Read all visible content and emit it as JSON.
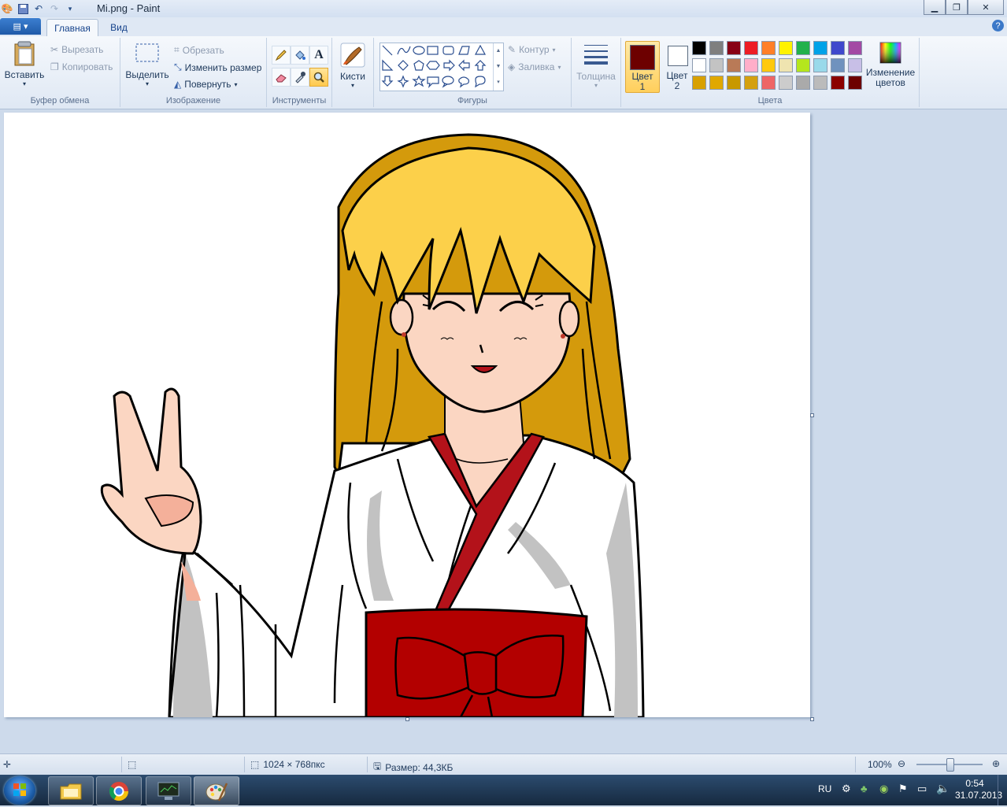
{
  "window": {
    "title": "Mi.png - Paint"
  },
  "tabs": {
    "file": "▤ ▾",
    "home": "Главная",
    "view": "Вид",
    "help": "?"
  },
  "clipboard": {
    "paste": "Вставить",
    "cut": "Вырезать",
    "copy": "Копировать",
    "label": "Буфер обмена"
  },
  "image": {
    "select": "Выделить",
    "crop": "Обрезать",
    "resize": "Изменить размер",
    "rotate": "Повернуть",
    "label": "Изображение"
  },
  "tools": {
    "label": "Инструменты"
  },
  "brushes": {
    "label": "Кисти"
  },
  "shapes": {
    "outline": "Контур",
    "fill": "Заливка",
    "label": "Фигуры"
  },
  "size": {
    "label": "Толщина"
  },
  "colors": {
    "color1_label": "Цвет",
    "color1_num": "1",
    "color2_label": "Цвет",
    "color2_num": "2",
    "edit_line1": "Изменение",
    "edit_line2": "цветов",
    "label": "Цвета",
    "color1_value": "#6d0000",
    "color2_value": "#ffffff",
    "palette": [
      "#000000",
      "#7f7f7f",
      "#880015",
      "#ed1c24",
      "#ff7f27",
      "#fff200",
      "#22b14c",
      "#00a2e8",
      "#3f48cc",
      "#a349a4",
      "#ffffff",
      "#c3c3c3",
      "#b97a57",
      "#ffaec9",
      "#ffc90e",
      "#efe4b0",
      "#b5e61d",
      "#99d9ea",
      "#7092be",
      "#c8bfe7",
      "#d8a000",
      "#e0a800",
      "#c89800",
      "#d4a010",
      "#ee6666",
      "#cccccc",
      "#aaaaaa",
      "#bbbbbb",
      "#8b0000",
      "#6d0000"
    ]
  },
  "status": {
    "dimensions": "1024 × 768пкс",
    "filesize": "Размер: 44,3КБ",
    "zoom": "100%"
  },
  "taskbar": {
    "lang": "RU",
    "time": "0:54",
    "date": "31.07.2013"
  }
}
